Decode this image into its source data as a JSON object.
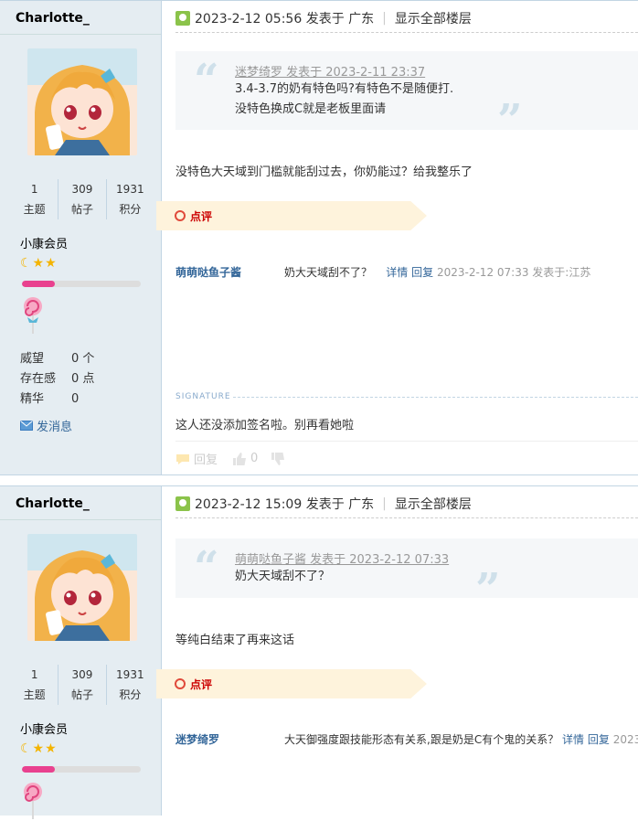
{
  "posts": [
    {
      "author": "Charlotte_",
      "stats": [
        {
          "num": "1",
          "label": "主题"
        },
        {
          "num": "309",
          "label": "帖子"
        },
        {
          "num": "1931",
          "label": "积分"
        }
      ],
      "group": "小康会员",
      "stars": "☾★★",
      "progress": 0.28,
      "info": [
        {
          "k": "威望",
          "v": "0 个"
        },
        {
          "k": "存在感",
          "v": "0 点"
        },
        {
          "k": "精华",
          "v": "0"
        }
      ],
      "pm_label": "发消息",
      "posted": "2023-2-12 05:56 发表于 广东",
      "show_all": "显示全部楼层",
      "quote": {
        "author": "迷梦绮罗 发表于 2023-2-11 23:37",
        "lines": [
          "3.4-3.7的奶有特色吗?有特色不是随便打.",
          "没特色换成C就是老板里面请"
        ]
      },
      "body": "没特色大天域到门槛就能刮过去，你奶能过？给我整乐了",
      "dianping_label": "点评",
      "comment": {
        "who": "萌萌哒鱼子酱",
        "text": "奶大天域刮不了？",
        "detail": "详情",
        "reply": "回复",
        "time": "2023-2-12 07:33 发表于:江苏"
      },
      "signature_label": "SIGNATURE",
      "signature_text": "这人还没添加签名啦。别再看她啦",
      "actions": {
        "reply": "回复",
        "likes": "0"
      }
    },
    {
      "author": "Charlotte_",
      "stats": [
        {
          "num": "1",
          "label": "主题"
        },
        {
          "num": "309",
          "label": "帖子"
        },
        {
          "num": "1931",
          "label": "积分"
        }
      ],
      "group": "小康会员",
      "stars": "☾★★",
      "progress": 0.28,
      "posted": "2023-2-12 15:09 发表于 广东",
      "show_all": "显示全部楼层",
      "quote": {
        "author": "萌萌哒鱼子酱 发表于 2023-2-12 07:33",
        "lines": [
          "奶大天域刮不了？"
        ]
      },
      "body": "等纯白结束了再来这话",
      "dianping_label": "点评",
      "comment": {
        "who": "迷梦绮罗",
        "text": "大天御强度跟技能形态有关系,跟是奶是C有个鬼的关系？",
        "detail": "详情",
        "reply": "回复",
        "time": "2023-"
      }
    }
  ],
  "colors": {
    "accent": "#336699",
    "pink": "#e9418f",
    "side_bg": "#e5edf2"
  },
  "icons": [
    "online-icon",
    "quote-open-icon",
    "quote-close-icon",
    "mail-icon",
    "lollipop-medal-icon",
    "reply-icon",
    "thumb-up-icon",
    "thumb-down-icon"
  ]
}
